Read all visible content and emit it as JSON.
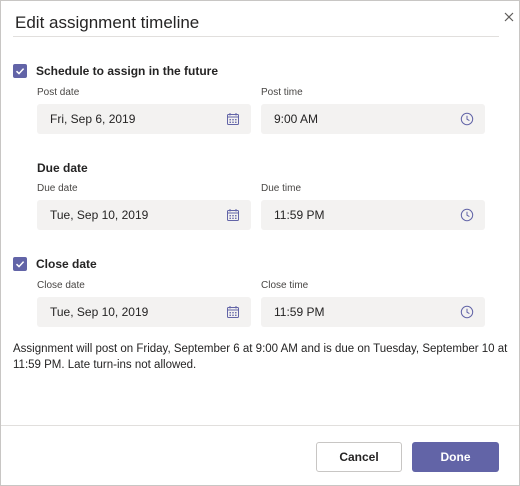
{
  "dialog": {
    "title": "Edit assignment timeline"
  },
  "schedule": {
    "checked": true,
    "label": "Schedule to assign in the future",
    "post_date_label": "Post date",
    "post_date_value": "Fri, Sep 6, 2019",
    "post_time_label": "Post time",
    "post_time_value": "9:00 AM"
  },
  "due": {
    "section_label": "Due date",
    "due_date_label": "Due date",
    "due_date_value": "Tue, Sep 10, 2019",
    "due_time_label": "Due time",
    "due_time_value": "11:59 PM"
  },
  "close": {
    "checked": true,
    "label": "Close date",
    "close_date_label": "Close date",
    "close_date_value": "Tue, Sep 10, 2019",
    "close_time_label": "Close time",
    "close_time_value": "11:59 PM"
  },
  "summary": "Assignment will post on Friday, September 6 at 9:00 AM and is due on Tuesday, September 10 at 11:59 PM. Late turn-ins not allowed.",
  "footer": {
    "cancel_label": "Cancel",
    "done_label": "Done"
  },
  "colors": {
    "accent": "#6264a7",
    "field_bg": "#f3f2f1",
    "icon": "#6264a7"
  },
  "icons": {
    "close": "close-icon",
    "calendar": "calendar-icon",
    "clock": "clock-icon",
    "check": "checkmark-icon"
  }
}
